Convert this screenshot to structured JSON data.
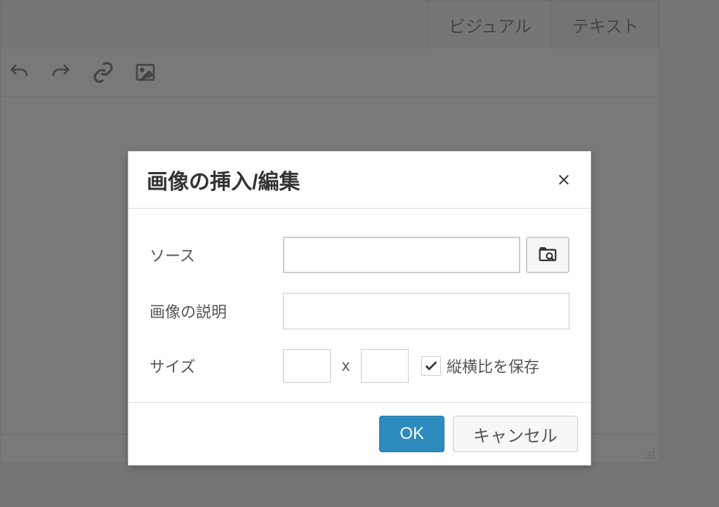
{
  "tabs": {
    "visual": "ビジュアル",
    "text": "テキスト"
  },
  "dialog": {
    "title": "画像の挿入/編集",
    "source_label": "ソース",
    "source_value": "",
    "desc_label": "画像の説明",
    "desc_value": "",
    "size_label": "サイズ",
    "width_value": "",
    "height_value": "",
    "size_separator": "x",
    "aspect_label": "縦横比を保存",
    "aspect_checked": true,
    "ok_label": "OK",
    "cancel_label": "キャンセル"
  }
}
